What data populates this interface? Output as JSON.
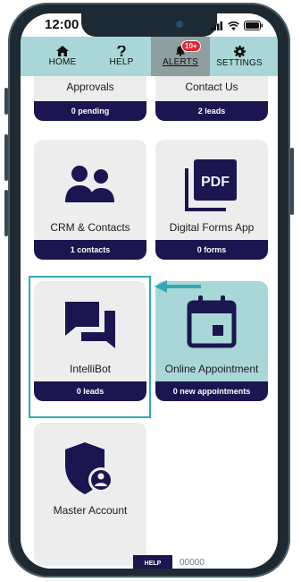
{
  "status_bar": {
    "time": "12:00"
  },
  "nav": {
    "items": [
      {
        "label": "HOME",
        "icon": "home-icon"
      },
      {
        "label": "HELP",
        "icon": "question-icon"
      },
      {
        "label": "ALERTS",
        "icon": "bell-icon",
        "badge": "10+",
        "active": true
      },
      {
        "label": "SETTINGS",
        "icon": "gear-icon"
      }
    ]
  },
  "tiles": [
    {
      "title": "Approvals",
      "status": "0 pending"
    },
    {
      "title": "Contact Us",
      "status": "2 leads"
    },
    {
      "title": "CRM & Contacts",
      "status": "1 contacts",
      "icon": "users-icon"
    },
    {
      "title": "Digital Forms App",
      "status": "0 forms",
      "icon": "pdf-icon"
    },
    {
      "title": "IntelliBot",
      "status": "0 leads",
      "icon": "chat-icon"
    },
    {
      "title": "Online Appointment",
      "status": "0 new appointments",
      "icon": "calendar-icon"
    },
    {
      "title": "Master Account",
      "icon": "shield-user-icon"
    }
  ],
  "footer": {
    "help_label": "HELP",
    "number": "00000"
  },
  "colors": {
    "navy": "#1b1550",
    "teal": "#a9d7d7",
    "highlight": "#33a9b6"
  }
}
